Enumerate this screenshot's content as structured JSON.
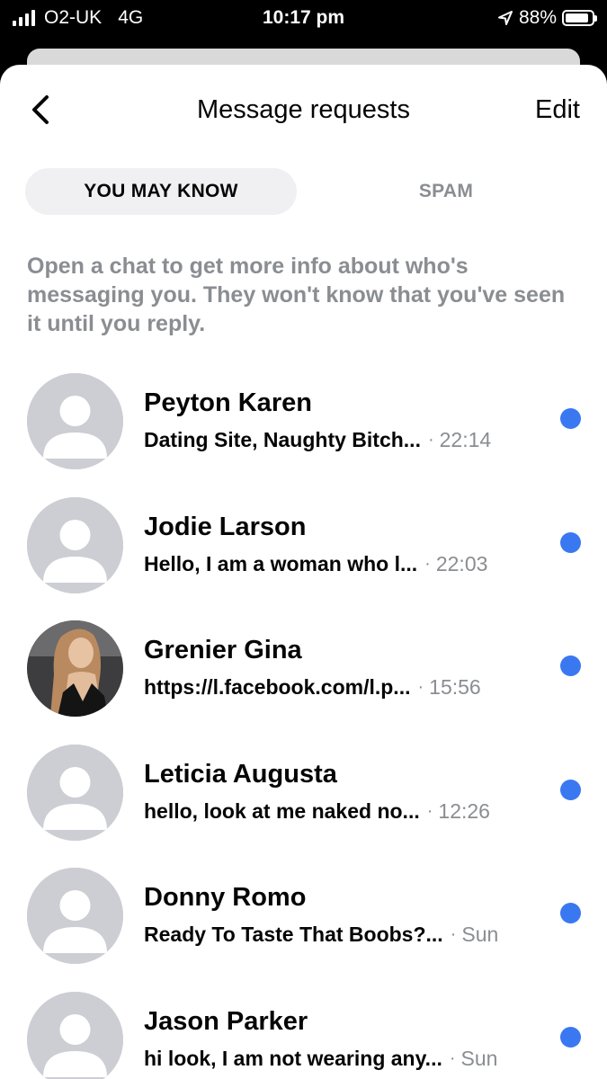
{
  "status_bar": {
    "carrier": "O2-UK",
    "network": "4G",
    "time": "10:17 pm",
    "battery": "88%",
    "battery_level": 0.88
  },
  "nav": {
    "title": "Message requests",
    "edit_label": "Edit",
    "back_icon": "chevron-left-icon"
  },
  "tabs": [
    {
      "label": "YOU MAY KNOW",
      "active": true
    },
    {
      "label": "SPAM",
      "active": false
    }
  ],
  "info_text": "Open a chat to get more info about who's messaging you. They won't know that you've seen it until you reply.",
  "requests": [
    {
      "name": "Peyton Karen",
      "preview": "Dating Site, Naughty Bitch...",
      "time": "22:14",
      "unread": true,
      "avatar": "default-avatar"
    },
    {
      "name": "Jodie Larson",
      "preview": "Hello, I am a woman who l...",
      "time": "22:03",
      "unread": true,
      "avatar": "default-avatar"
    },
    {
      "name": "Grenier Gina",
      "preview": "https://l.facebook.com/l.p...",
      "time": "15:56",
      "unread": true,
      "avatar": "photo-avatar"
    },
    {
      "name": "Leticia Augusta",
      "preview": "hello, look at me naked no...",
      "time": "12:26",
      "unread": true,
      "avatar": "default-avatar"
    },
    {
      "name": "Donny Romo",
      "preview": "Ready To Taste That Boobs?...",
      "time": "Sun",
      "unread": true,
      "avatar": "default-avatar"
    },
    {
      "name": "Jason Parker",
      "preview": "hi look, I am not wearing any...",
      "time": "Sun",
      "unread": true,
      "avatar": "default-avatar"
    }
  ],
  "colors": {
    "unread_dot": "#3a78f2",
    "avatar_bg": "#cdced3",
    "secondary_text": "#8a8d91",
    "tab_active_bg": "#f0f0f2"
  }
}
